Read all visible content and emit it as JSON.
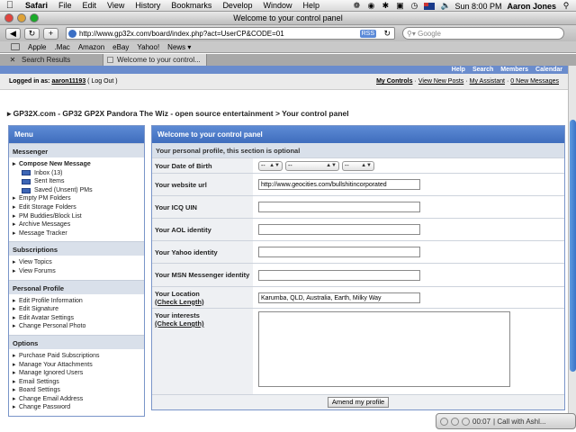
{
  "menubar": {
    "items": [
      "Safari",
      "File",
      "Edit",
      "View",
      "History",
      "Bookmarks",
      "Develop",
      "Window",
      "Help"
    ],
    "clock": "Sun 8:00 PM",
    "user": "Aaron Jones"
  },
  "window": {
    "title": "Welcome to your control panel"
  },
  "toolbar": {
    "url": "http://www.gp32x.com/board/index.php?act=UserCP&CODE=01",
    "rss": "RSS",
    "search_placeholder": "Google"
  },
  "bookmarks": [
    "Apple",
    ".Mac",
    "Amazon",
    "eBay",
    "Yahoo!",
    "News ▾"
  ],
  "tabs": [
    {
      "label": "Search Results"
    },
    {
      "label": "Welcome to your control..."
    }
  ],
  "topnav": [
    "Help",
    "Search",
    "Members",
    "Calendar"
  ],
  "userbar": {
    "logged_label": "Logged in as:",
    "username": "aaron11193",
    "logout": "( Log Out )",
    "links": [
      "My Controls",
      " · ",
      "View New Posts",
      " · ",
      "My Assistant",
      " · ",
      "0 New Messages"
    ]
  },
  "breadcrumb": "▸ GP32X.com - GP32 GP2X Pandora The Wiz - open source entertainment > Your control panel",
  "menu": {
    "title": "Menu",
    "sections": [
      {
        "title": "Messenger",
        "items": [
          {
            "label": "Compose New Message",
            "style": "bold"
          },
          {
            "label": "Inbox (13)",
            "style": "sub"
          },
          {
            "label": "Sent Items",
            "style": "sub"
          },
          {
            "label": "Saved (Unsent) PMs",
            "style": "sub"
          },
          {
            "label": "Empty PM Folders"
          },
          {
            "label": "Edit Storage Folders"
          },
          {
            "label": "PM Buddies/Block List"
          },
          {
            "label": "Archive Messages"
          },
          {
            "label": "Message Tracker"
          }
        ]
      },
      {
        "title": "Subscriptions",
        "items": [
          {
            "label": "View Topics"
          },
          {
            "label": "View Forums"
          }
        ]
      },
      {
        "title": "Personal Profile",
        "items": [
          {
            "label": "Edit Profile Information"
          },
          {
            "label": "Edit Signature"
          },
          {
            "label": "Edit Avatar Settings"
          },
          {
            "label": "Change Personal Photo"
          }
        ]
      },
      {
        "title": "Options",
        "items": [
          {
            "label": "Purchase Paid Subscriptions"
          },
          {
            "label": "Manage Your Attachments"
          },
          {
            "label": "Manage Ignored Users"
          },
          {
            "label": "Email Settings"
          },
          {
            "label": "Board Settings"
          },
          {
            "label": "Change Email Address"
          },
          {
            "label": "Change Password"
          }
        ]
      }
    ]
  },
  "panel": {
    "title": "Welcome to your control panel",
    "subtitle": "Your personal profile, this section is optional",
    "dob": {
      "label": "Your Date of Birth",
      "day": "--",
      "month": "--",
      "year": "--"
    },
    "website": {
      "label": "Your website url",
      "value": "http://www.geocities.com/bullshitincorporated"
    },
    "icq": {
      "label": "Your ICQ UIN",
      "value": ""
    },
    "aol": {
      "label": "Your AOL identity",
      "value": ""
    },
    "yahoo": {
      "label": "Your Yahoo identity",
      "value": ""
    },
    "msn": {
      "label": "Your MSN Messenger identity",
      "value": ""
    },
    "location": {
      "label": "Your Location",
      "check": "(Check Length)",
      "value": "Karumba, QLD, Australia, Earth, Milky Way"
    },
    "interests": {
      "label": "Your interests",
      "check": "(Check Length)",
      "value": ""
    },
    "submit": "Amend my profile"
  },
  "call_widget": {
    "time": "00:07",
    "text": "| Call with Ashl..."
  }
}
